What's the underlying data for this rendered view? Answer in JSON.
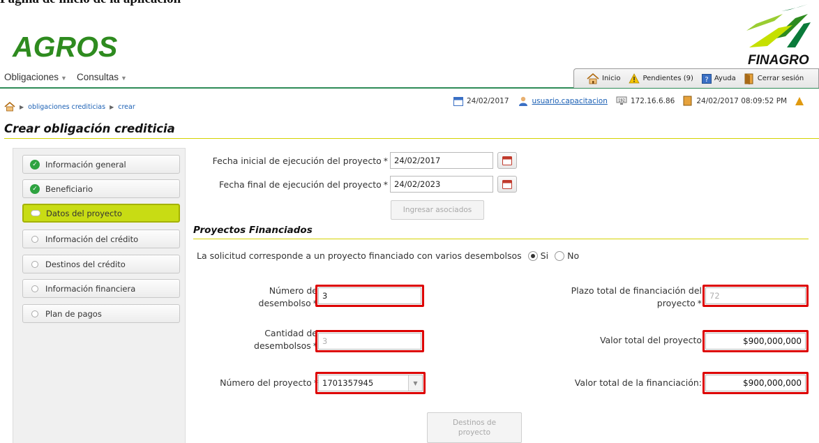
{
  "document_heading": "Página de inicio de la aplicación",
  "logos": {
    "app": "AGROS",
    "brand": "FINAGRO"
  },
  "top_menu": [
    {
      "label": "Obligaciones"
    },
    {
      "label": "Consultas"
    }
  ],
  "util_tabs": [
    {
      "label": "Inicio",
      "icon": "home-icon"
    },
    {
      "label": "Pendientes (9)",
      "icon": "warning-icon"
    },
    {
      "label": "Ayuda",
      "icon": "help-icon"
    },
    {
      "label": "Cerrar sesión",
      "icon": "door-icon"
    }
  ],
  "status": {
    "date": "24/02/2017",
    "user": "usuario.capacitacion",
    "ip": "172.16.6.86",
    "datetime": "24/02/2017 08:09:52 PM"
  },
  "breadcrumb": [
    "obligaciones crediticias",
    "crear"
  ],
  "page_title": "Crear obligación crediticia",
  "steps": [
    {
      "label": "Información general",
      "state": "done"
    },
    {
      "label": "Beneficiario",
      "state": "done"
    },
    {
      "label": "Datos del proyecto",
      "state": "current"
    },
    {
      "label": "Información del crédito",
      "state": "pending"
    },
    {
      "label": "Destinos del crédito",
      "state": "pending"
    },
    {
      "label": "Información financiera",
      "state": "pending"
    },
    {
      "label": "Plan de pagos",
      "state": "pending"
    }
  ],
  "form": {
    "fecha_inicial_label": "Fecha inicial de ejecución del proyecto",
    "fecha_inicial_value": "24/02/2017",
    "fecha_final_label": "Fecha final de ejecución del proyecto",
    "fecha_final_value": "24/02/2023",
    "ingresar_asociados": "Ingresar asociados",
    "required_mark": "*"
  },
  "proyectos": {
    "section_title": "Proyectos Financiados",
    "question": "La solicitud corresponde a un proyecto financiado con varios desembolsos",
    "option_si": "Si",
    "option_no": "No",
    "selected": "Si",
    "numero_desembolso_label_1": "Número de",
    "numero_desembolso_label_2": "desembolso",
    "numero_desembolso_value": "3",
    "cantidad_desembolsos_label_1": "Cantidad de",
    "cantidad_desembolsos_label_2": "desembolsos",
    "cantidad_desembolsos_value": "3",
    "numero_proyecto_label": "Número del proyecto",
    "numero_proyecto_value": "1701357945",
    "plazo_total_label_1": "Plazo total de financiación del",
    "plazo_total_label_2": "proyecto",
    "plazo_total_value": "72",
    "valor_total_proyecto_label": "Valor total del proyecto",
    "valor_total_proyecto_value": "$900,000,000",
    "valor_total_financiacion_label": "Valor total de la financiación:",
    "valor_total_financiacion_value": "$900,000,000",
    "destinos_button_1": "Destinos de",
    "destinos_button_2": "proyecto"
  },
  "colors": {
    "brand_green": "#2e8b1f",
    "active_step": "#c8dc14",
    "highlight_red": "#dd0000",
    "divider_yellow": "#d4d200"
  }
}
